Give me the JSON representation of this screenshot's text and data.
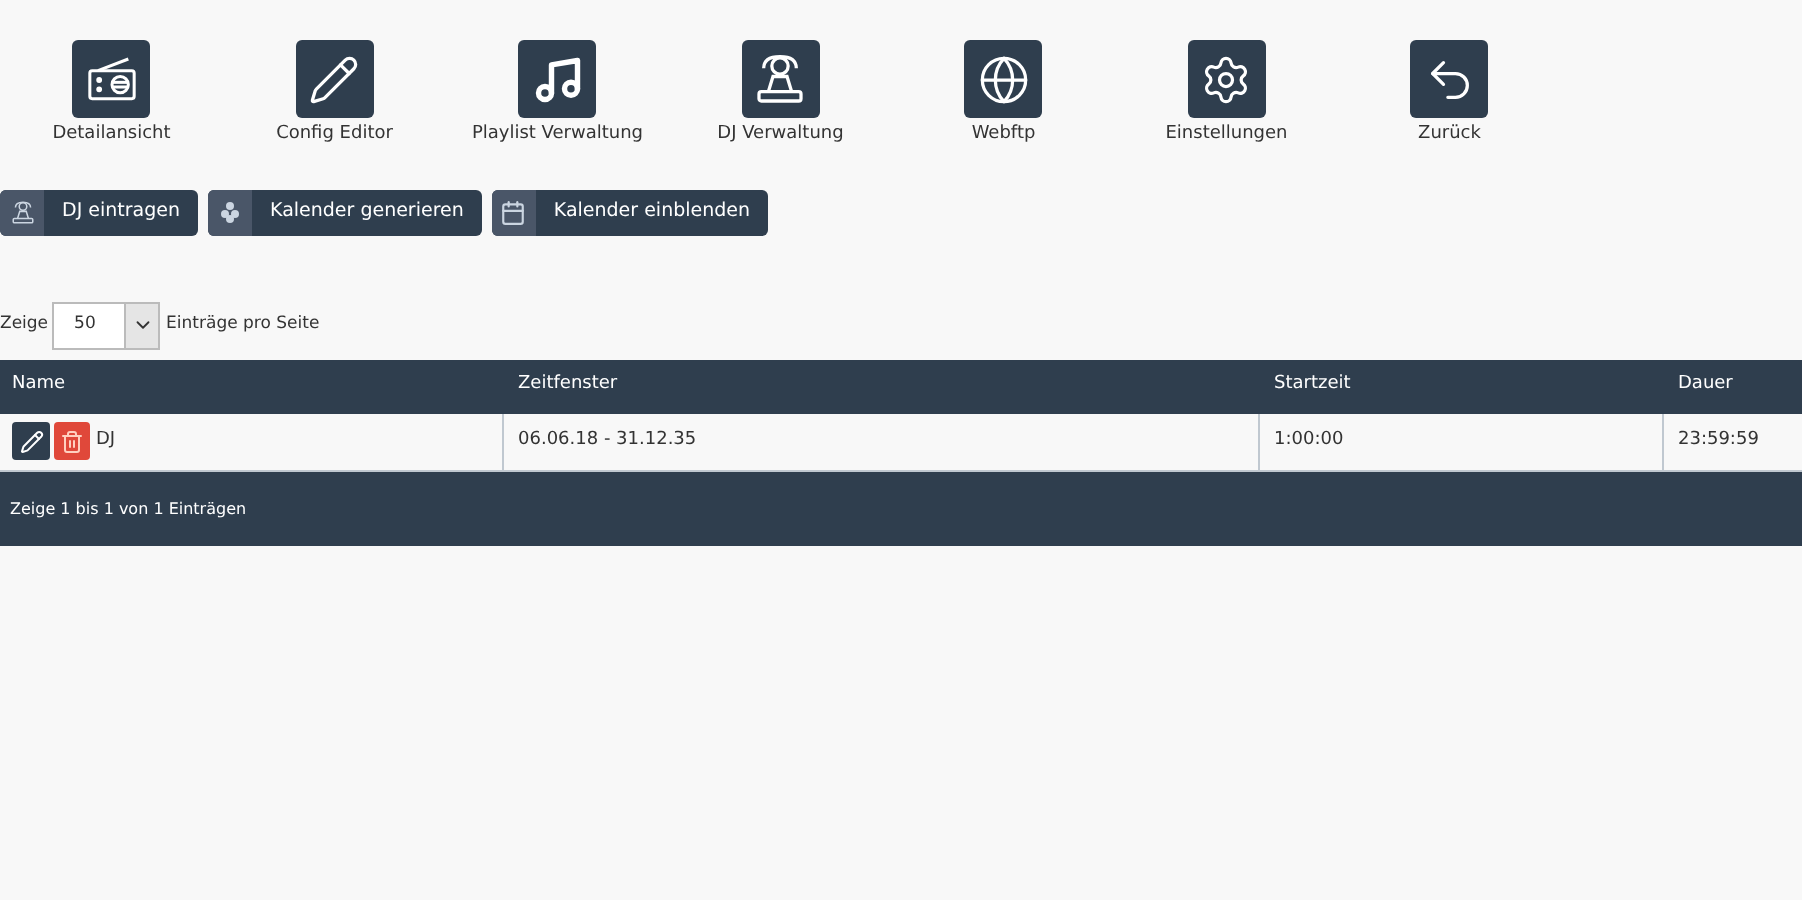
{
  "nav": [
    {
      "label": "Detailansicht",
      "kind": "radio"
    },
    {
      "label": "Config Editor",
      "kind": "pencil"
    },
    {
      "label": "Playlist Verwaltung",
      "kind": "music"
    },
    {
      "label": "DJ Verwaltung",
      "kind": "dj"
    },
    {
      "label": "Webftp",
      "kind": "globe"
    },
    {
      "label": "Einstellungen",
      "kind": "gears"
    },
    {
      "label": "Zurück",
      "kind": "back"
    }
  ],
  "actions": [
    {
      "label": "DJ eintragen",
      "kind": "dj"
    },
    {
      "label": "Kalender generieren",
      "kind": "generate"
    },
    {
      "label": "Kalender einblenden",
      "kind": "calendar"
    }
  ],
  "page_length": {
    "prefix": "Zeige",
    "value": "50",
    "suffix": "Einträge pro Seite"
  },
  "table": {
    "columns": [
      "Name",
      "Zeitfenster",
      "Startzeit",
      "Dauer"
    ],
    "rows": [
      {
        "name": "DJ",
        "zeitfenster": "06.06.18 - 31.12.35",
        "startzeit": "1:00:00",
        "dauer": "23:59:59"
      }
    ],
    "info": "Zeige 1 bis 1 von 1 Einträgen"
  }
}
